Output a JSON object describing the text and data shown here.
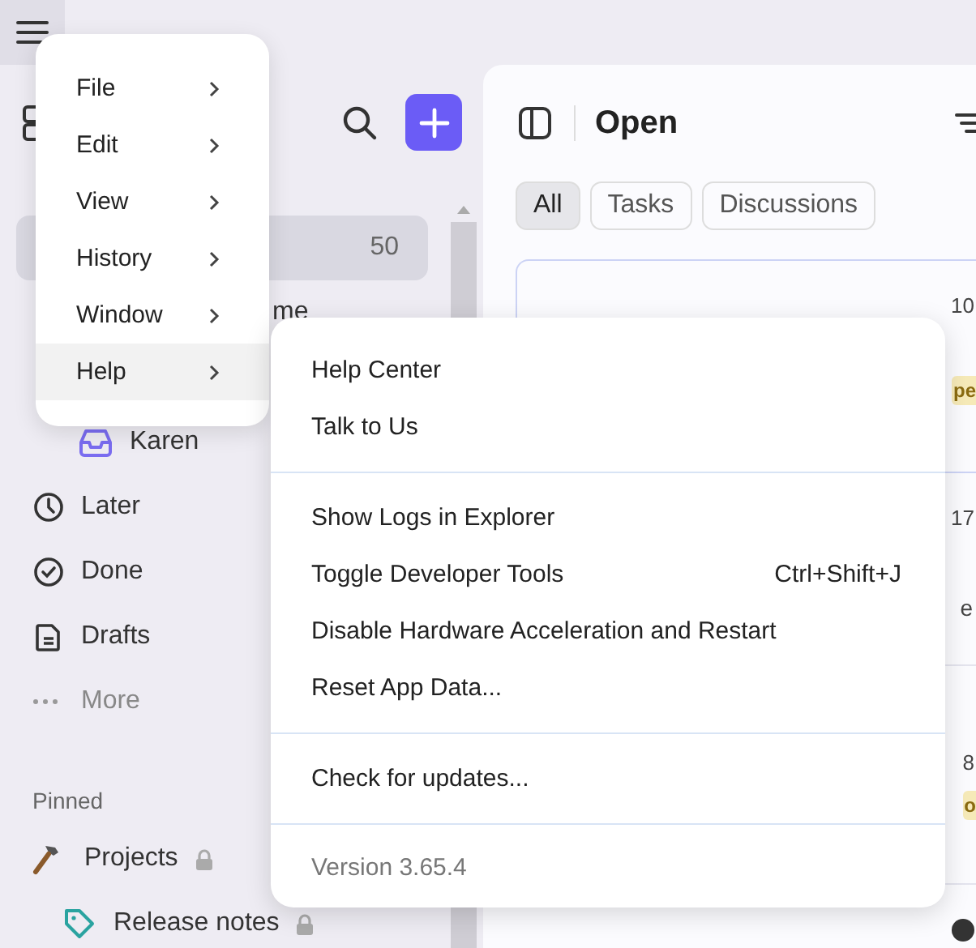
{
  "sidebar": {
    "items": [
      {
        "kind": "count-only",
        "count": "50",
        "selected": true
      },
      {
        "kind": "partial",
        "label": "me",
        "selected": false
      },
      {
        "kind": "inbox",
        "label": "Karen",
        "selected": false
      },
      {
        "kind": "later",
        "label": "Later",
        "selected": false
      },
      {
        "kind": "done",
        "label": "Done",
        "selected": false
      },
      {
        "kind": "drafts",
        "label": "Drafts",
        "selected": false
      },
      {
        "kind": "more",
        "label": "More",
        "selected": false
      }
    ],
    "pinned": {
      "heading": "Pinned",
      "items": [
        {
          "kind": "hammer",
          "label": "Projects",
          "locked": true,
          "children": [
            {
              "kind": "tag",
              "label": "Release notes",
              "locked": true
            }
          ]
        }
      ]
    }
  },
  "main": {
    "title": "Open",
    "tabs": [
      {
        "label": "All",
        "selected": true
      },
      {
        "label": "Tasks",
        "selected": false
      },
      {
        "label": "Discussions",
        "selected": false
      }
    ],
    "rows": [
      {
        "time": "10",
        "badge": "pe",
        "extra": ""
      },
      {
        "time": "17",
        "badge": "",
        "extra": "e"
      },
      {
        "time": "8",
        "badge": "o",
        "extra": ""
      },
      {
        "time": "",
        "badge": "",
        "extra": "",
        "kind": "avatar"
      }
    ]
  },
  "menu": {
    "items": [
      {
        "label": "File",
        "selected": false
      },
      {
        "label": "Edit",
        "selected": false
      },
      {
        "label": "View",
        "selected": false
      },
      {
        "label": "History",
        "selected": false
      },
      {
        "label": "Window",
        "selected": false
      },
      {
        "label": "Help",
        "selected": true
      }
    ]
  },
  "submenu": {
    "groups": [
      [
        {
          "label": "Help Center"
        },
        {
          "label": "Talk to Us"
        }
      ],
      [
        {
          "label": "Show Logs in Explorer"
        },
        {
          "label": "Toggle Developer Tools",
          "shortcut": "Ctrl+Shift+J"
        },
        {
          "label": "Disable Hardware Acceleration and Restart"
        },
        {
          "label": "Reset App Data..."
        }
      ],
      [
        {
          "label": "Check for updates..."
        }
      ]
    ],
    "version": "Version 3.65.4"
  }
}
